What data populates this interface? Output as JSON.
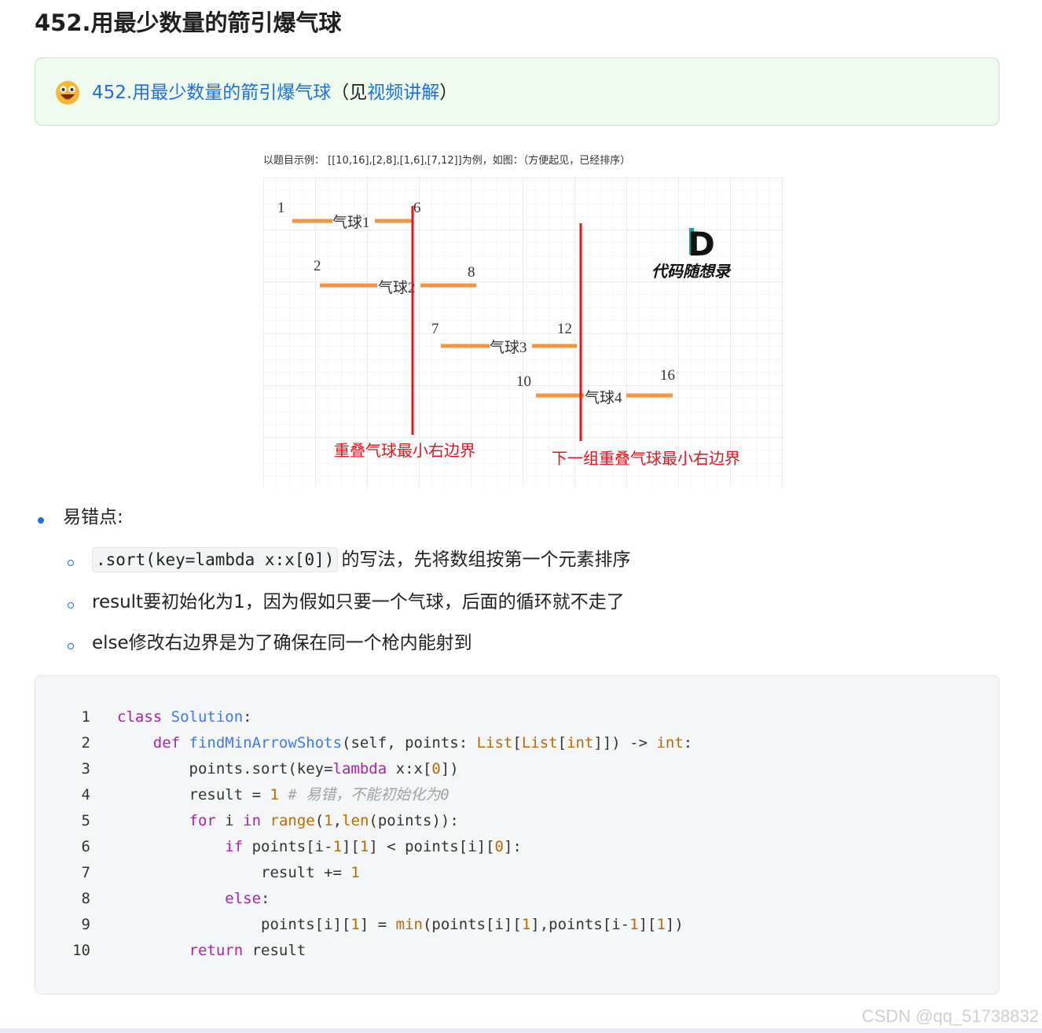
{
  "page": {
    "title": "452.用最少数量的箭引爆气球"
  },
  "callout": {
    "icon": "grinning-face-emoji-icon",
    "link_text": "452.用最少数量的箭引爆气球",
    "paren_open": "（见",
    "video_link": "视频讲解",
    "paren_close": "）"
  },
  "figure": {
    "caption": "以题目示例： [[10,16],[2,8],[1,6],[7,12]]为例，如图：（方便起见，已经排序）",
    "balloons": [
      {
        "label": "气球1",
        "start": "1",
        "end": "6"
      },
      {
        "label": "气球2",
        "start": "2",
        "end": "8"
      },
      {
        "label": "气球3",
        "start": "7",
        "end": "12"
      },
      {
        "label": "气球4",
        "start": "10",
        "end": "16"
      }
    ],
    "line1_label": "重叠气球最小右边界",
    "line2_label": "下一组重叠气球最小右边界",
    "logo_letter": "D",
    "logo_text": "代码随想录"
  },
  "bullets": {
    "heading": "易错点:",
    "items": [
      {
        "code": ".sort(key=lambda x:x[0])",
        "text": "的写法，先将数组按第一个元素排序"
      },
      {
        "text": "result要初始化为1，因为假如只要一个气球，后面的循环就不走了"
      },
      {
        "text": "else修改右边界是为了确保在同一个枪内能射到"
      }
    ]
  },
  "code": {
    "line_numbers": [
      "1",
      "2",
      "3",
      "4",
      "5",
      "6",
      "7",
      "8",
      "9",
      "10"
    ],
    "lines": [
      "class Solution:",
      "    def findMinArrowShots(self, points: List[List[int]]) -> int:",
      "        points.sort(key=lambda x:x[0])",
      "        result = 1 # 易错，不能初始化为0",
      "        for i in range(1,len(points)):",
      "            if points[i-1][1] < points[i][0]:",
      "                result += 1",
      "            else:",
      "                points[i][1] = min(points[i][1],points[i-1][1])",
      "        return result"
    ]
  },
  "watermark": "CSDN @qq_51738832",
  "colors": {
    "link": "#1e6fd9",
    "callout_bg": "#eefbee",
    "balloon_bar": "#f5943f",
    "arrow_line": "#e0151f",
    "keyword": "#a626a4",
    "function": "#4078f2",
    "number": "#b76b01",
    "comment": "#a0a1a7"
  }
}
